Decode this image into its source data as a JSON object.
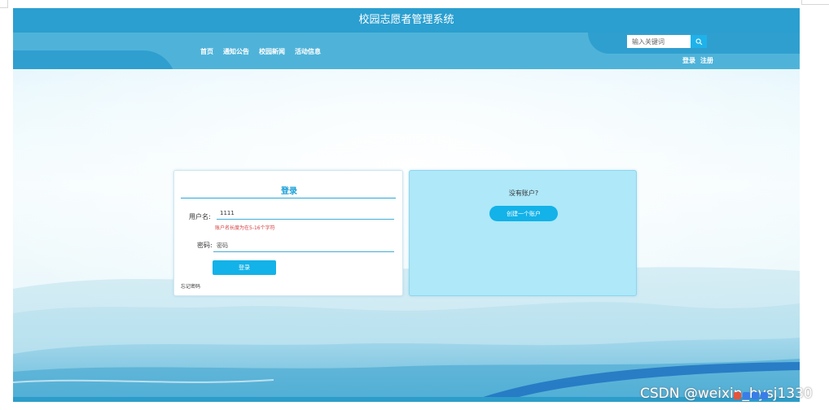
{
  "header": {
    "site_title": "校园志愿者管理系统",
    "nav_items": [
      "首页",
      "通知公告",
      "校园新闻",
      "活动信息"
    ],
    "search_placeholder": "输入关键词",
    "auth_links": [
      "登录",
      "注册"
    ]
  },
  "login": {
    "title": "登录",
    "username_label": "用户名:",
    "username_value": "1111",
    "username_error": "账户名长度为在5-16个字符",
    "password_label": "密码:",
    "password_placeholder": "密码",
    "submit_label": "登录",
    "forgot_label": "忘记密码"
  },
  "register": {
    "question": "没有账户?",
    "button_label": "创建一个账户"
  },
  "watermark": "CSDN @weixin_bysj1330",
  "colors": {
    "primary": "#2a9fd0",
    "accent_button": "#13b2e8",
    "error": "#d43c3c",
    "register_card_bg": "#aee8f9"
  },
  "icons": {
    "search": "search-icon"
  }
}
